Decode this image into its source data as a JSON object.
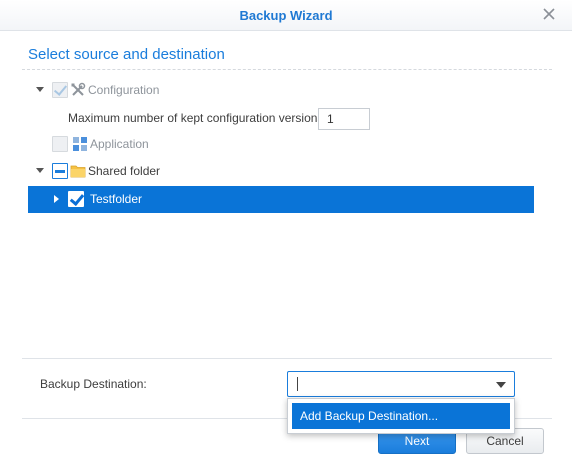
{
  "window": {
    "title": "Backup Wizard"
  },
  "page": {
    "section_title": "Select source and destination"
  },
  "tree": {
    "configuration": {
      "label": "Configuration",
      "checked": true,
      "disabled": true
    },
    "versions": {
      "label": "Maximum number of kept configuration versions",
      "value": "1"
    },
    "application": {
      "label": "Application",
      "disabled": true
    },
    "shared_folder": {
      "label": "Shared folder",
      "state": "partial"
    },
    "testfolder": {
      "label": "Testfolder",
      "checked": true,
      "selected": true
    }
  },
  "destination": {
    "label": "Backup Destination:",
    "value": "",
    "options": [
      "Add Backup Destination..."
    ]
  },
  "buttons": {
    "next": "Next",
    "cancel": "Cancel"
  },
  "colors": {
    "accent": "#1a7ddc",
    "selection": "#0a74d7",
    "title": "#1f79d3"
  },
  "icons": {
    "close": "close-icon",
    "configuration": "tools-icon",
    "application": "application-grid-icon",
    "shared_folder": "folder-icon"
  }
}
